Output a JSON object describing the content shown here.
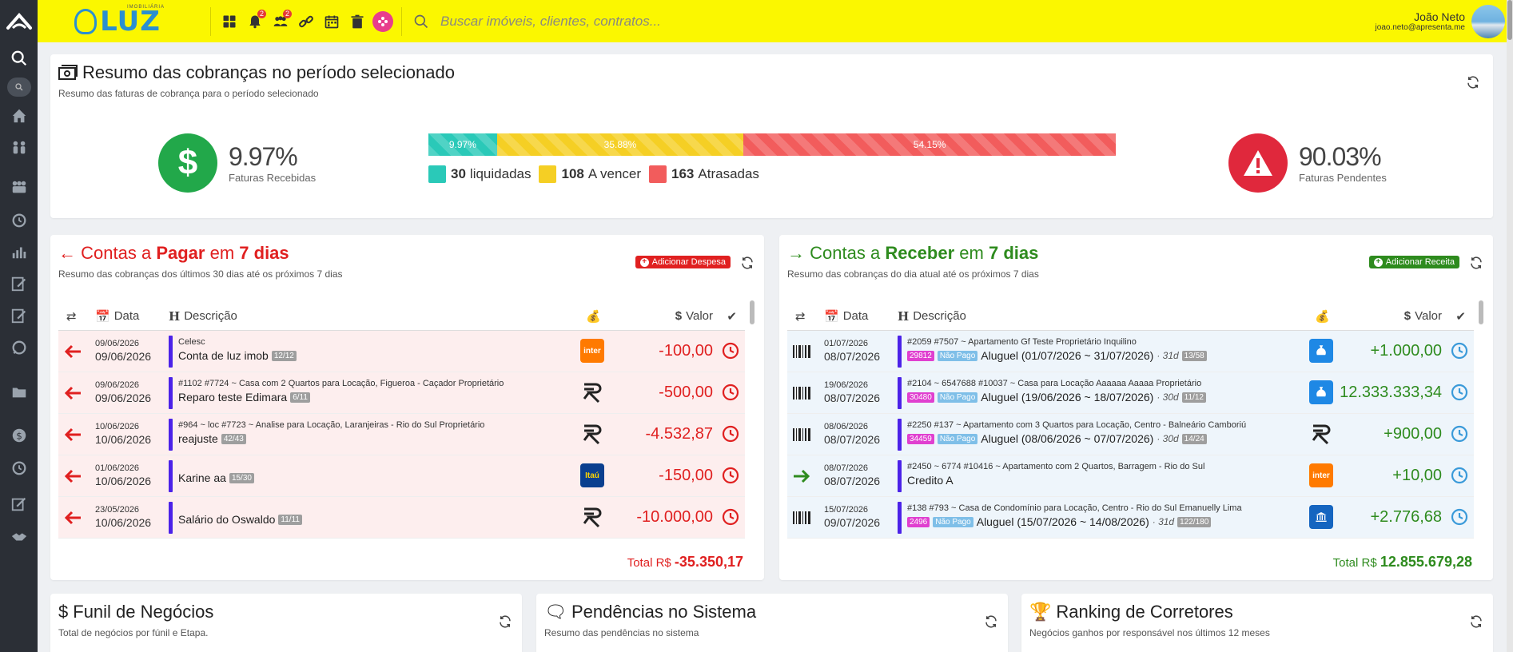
{
  "header": {
    "brand_small": "IMOBILIÁRIA",
    "brand": "LUZ",
    "search_placeholder": "Buscar imóveis, clientes, contratos...",
    "user_name": "João Neto",
    "user_email": "joao.neto@apresenta.me",
    "badges": {
      "notifications": "2",
      "users": "2"
    }
  },
  "summary": {
    "title": "Resumo das cobranças no período selecionado",
    "subtitle": "Resumo das faturas de cobrança para o período selecionado",
    "received_pct": "9.97%",
    "received_label": "Faturas Recebidas",
    "pending_pct": "90.03%",
    "pending_label": "Faturas Pendentes",
    "segments": [
      {
        "label": "9.97%",
        "value": 9.97,
        "color": "#2ac9b8"
      },
      {
        "label": "35.88%",
        "value": 35.88,
        "color": "#f5cf24"
      },
      {
        "label": "54.15%",
        "value": 54.15,
        "color": "#f25c5c"
      }
    ],
    "legend": [
      {
        "count": "30",
        "label": "liquidadas",
        "color": "#2ac9b8"
      },
      {
        "count": "108",
        "label": "A vencer",
        "color": "#f5cf24"
      },
      {
        "count": "163",
        "label": "Atrasadas",
        "color": "#f25c5c"
      }
    ],
    "received_color": "#22a84a",
    "pending_color": "#e0283c"
  },
  "pagar": {
    "title_a": "Contas a",
    "title_b": "Pagar",
    "title_c": "em",
    "title_d": "7 dias",
    "subtitle": "Resumo das cobranças dos últimos 30 dias até os próximos 7 dias",
    "button": "Adicionar Despesa",
    "col_data": "Data",
    "col_desc": "Descrição",
    "col_valor": "Valor",
    "total_label": "Total R$",
    "total_value": "-35.350,17",
    "rows": [
      {
        "d1": "09/06/2026",
        "d2": "09/06/2026",
        "meta": "Celesc",
        "desc": "Conta de luz imob",
        "chip": "12/12",
        "bank": "inter",
        "value": "-100,00"
      },
      {
        "d1": "09/06/2026",
        "d2": "09/06/2026",
        "meta": "#1102  #7724 ~ Casa com 2 Quartos para Locação, Figueroa - Caçador  Proprietário",
        "desc": "Reparo teste Edimara",
        "chip": "6/11",
        "bank": "R",
        "value": "-500,00"
      },
      {
        "d1": "10/06/2026",
        "d2": "10/06/2026",
        "meta": "#964 ~ loc  #7723 ~ Analise para Locação, Laranjeiras - Rio do Sul  Proprietário",
        "desc": "reajuste",
        "chip": "42/43",
        "bank": "R",
        "value": "-4.532,87"
      },
      {
        "d1": "01/06/2026",
        "d2": "10/06/2026",
        "meta": "",
        "desc": "Karine aa",
        "chip": "15/30",
        "bank": "itau",
        "value": "-150,00"
      },
      {
        "d1": "23/05/2026",
        "d2": "10/06/2026",
        "meta": "",
        "desc": "Salário do Oswaldo",
        "chip": "11/11",
        "bank": "R",
        "value": "-10.000,00"
      }
    ]
  },
  "receber": {
    "title_a": "Contas a",
    "title_b": "Receber",
    "title_c": "em",
    "title_d": "7 dias",
    "subtitle": "Resumo das cobranças do dia atual até os próximos 7 dias",
    "button": "Adicionar Receita",
    "col_data": "Data",
    "col_desc": "Descrição",
    "col_valor": "Valor",
    "total_label": "Total R$",
    "total_value": "12.855.679,28",
    "rows": [
      {
        "d1": "01/07/2026",
        "d2": "08/07/2026",
        "meta": "#2059  #7507 ~ Apartamento  Gf Teste  Proprietário  Inquilino",
        "id": "29812",
        "status": "Não Pago",
        "desc": "Aluguel (01/07/2026 ~ 31/07/2026)",
        "period": "· 31d",
        "chip": "13/58",
        "bank": "bag",
        "value": "+1.000,00",
        "icon": "barcode"
      },
      {
        "d1": "19/06/2026",
        "d2": "08/07/2026",
        "meta": "#2104 ~ 6547688  #10037 ~ Casa para Locação  Aaaaaa Aaaaa  Proprietário",
        "id": "30480",
        "status": "Não Pago",
        "desc": "Aluguel (19/06/2026 ~ 18/07/2026)",
        "period": "· 30d",
        "chip": "11/12",
        "bank": "bag",
        "value": "12.333.333,34",
        "icon": "barcode"
      },
      {
        "d1": "08/06/2026",
        "d2": "08/07/2026",
        "meta": "#2250  #137 ~ Apartamento com 3 Quartos para Locação, Centro - Balneário Camboriú",
        "id": "34459",
        "status": "Não Pago",
        "desc": "Aluguel (08/06/2026 ~ 07/07/2026)",
        "period": "· 30d",
        "chip": "14/24",
        "bank": "R",
        "value": "+900,00",
        "icon": "barcode"
      },
      {
        "d1": "08/07/2026",
        "d2": "08/07/2026",
        "meta": "#2450 ~ 6774  #10416 ~ Apartamento com 2 Quartos, Barragem - Rio do Sul",
        "id": "",
        "status": "",
        "desc": "Credito A",
        "period": "",
        "chip": "",
        "bank": "inter",
        "value": "+10,00",
        "icon": "arrow"
      },
      {
        "d1": "15/07/2026",
        "d2": "09/07/2026",
        "meta": "#138  #793 ~ Casa de Condomínio para Locação, Centro - Rio do Sul  Emanuelly Lima",
        "id": "2496",
        "status": "Não Pago",
        "desc": "Aluguel (15/07/2026 ~ 14/08/2026)",
        "period": "· 31d",
        "chip": "122/180",
        "bank": "bank",
        "value": "+2.776,68",
        "icon": "barcode"
      }
    ]
  },
  "funil": {
    "title": "Funil de Negócios",
    "subtitle": "Total de negócios por fúnil e Etapa."
  },
  "pendencias": {
    "title": "Pendências no Sistema",
    "subtitle": "Resumo das pendências no sistema"
  },
  "ranking": {
    "title": "Ranking de Corretores",
    "subtitle": "Negócios ganhos por responsável nos últimos 12 meses"
  },
  "colors": {
    "pay": "#e02020",
    "receive": "#2e8b1e",
    "row_pay_bg": "#fdeeee",
    "row_receive_bg": "#eef5fb",
    "bar": "#4b22e8"
  }
}
